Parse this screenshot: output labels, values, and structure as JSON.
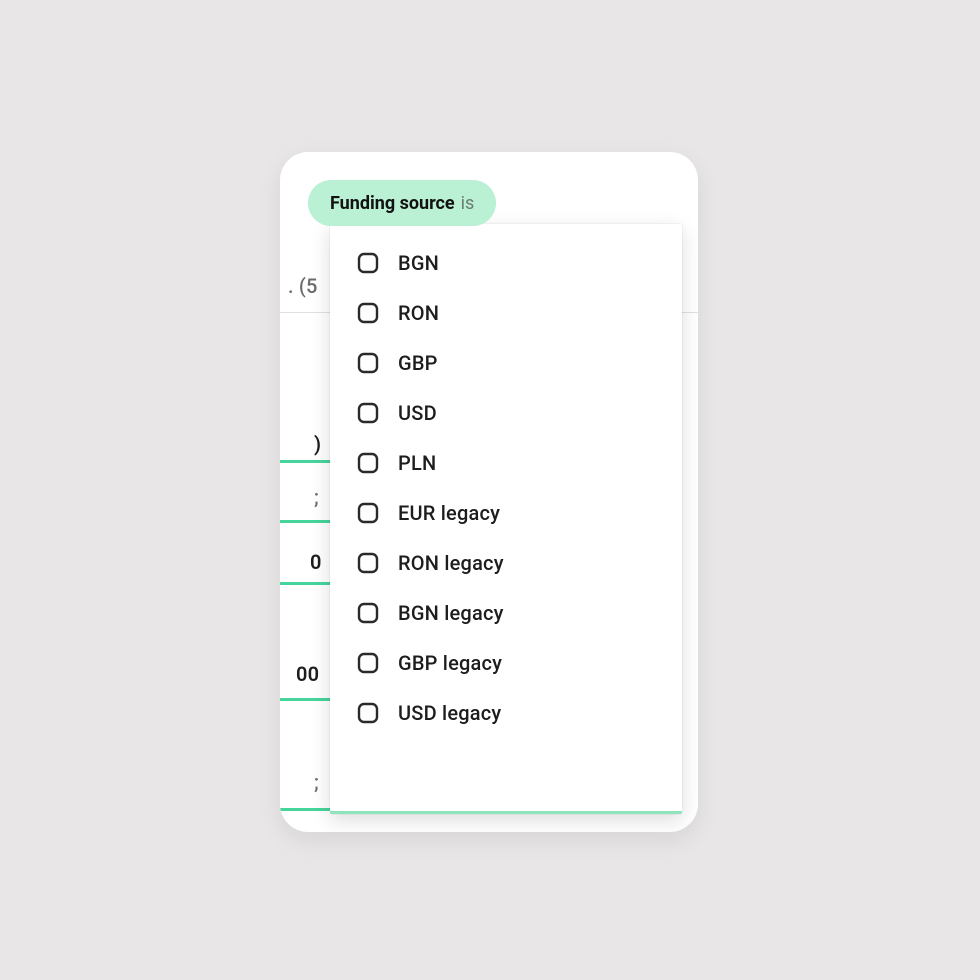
{
  "filter": {
    "pill_label_strong": "Funding source",
    "pill_label_weak": "is"
  },
  "background": {
    "frag_count": ". (5",
    "frag_row3_suffix": ")",
    "frag_row4_suffix": "0",
    "frag_row5_suffix": "00",
    "frag_row6_suffix": ";"
  },
  "options": [
    {
      "label": "BGN",
      "checked": false
    },
    {
      "label": "RON",
      "checked": false
    },
    {
      "label": "GBP",
      "checked": false
    },
    {
      "label": "USD",
      "checked": false
    },
    {
      "label": "PLN",
      "checked": false
    },
    {
      "label": "EUR legacy",
      "checked": false
    },
    {
      "label": "RON legacy",
      "checked": false
    },
    {
      "label": "BGN legacy",
      "checked": false
    },
    {
      "label": "GBP legacy",
      "checked": false
    },
    {
      "label": "USD legacy",
      "checked": false
    }
  ]
}
